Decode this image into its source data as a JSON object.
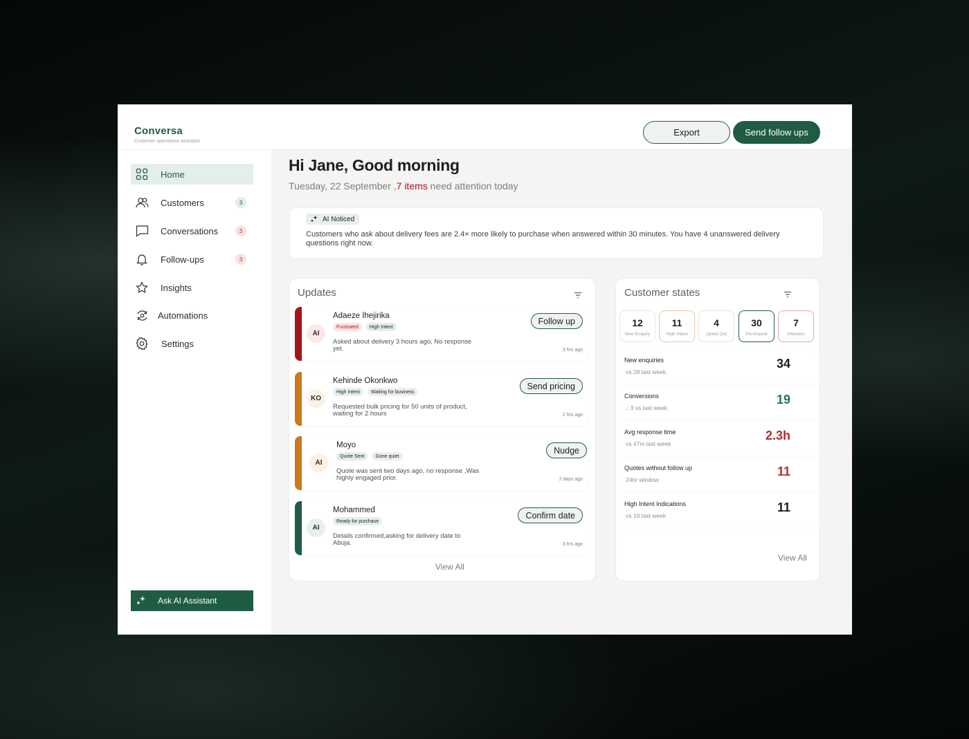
{
  "app": {
    "name": "Conversa",
    "tagline": "Customer operations assistant"
  },
  "header": {
    "export_label": "Export",
    "send_label": "Send follow ups"
  },
  "sidebar": {
    "items": [
      {
        "label": "Home",
        "icon": "grid-icon",
        "badge": ""
      },
      {
        "label": "Customers",
        "icon": "users-icon",
        "badge": "3"
      },
      {
        "label": "Conversations",
        "icon": "chat-icon",
        "badge": "3"
      },
      {
        "label": "Follow-ups",
        "icon": "bell-icon",
        "badge": "3"
      },
      {
        "label": "Insights",
        "icon": "star-icon",
        "badge": ""
      },
      {
        "label": "Automations",
        "icon": "automation-icon",
        "badge": ""
      },
      {
        "label": "Settings",
        "icon": "gear-icon",
        "badge": ""
      }
    ],
    "ask_ai_label": "Ask AI Assistant"
  },
  "greeting": {
    "title": "Hi Jane, Good morning",
    "date": "Tuesday, 22 September ,",
    "count": "7 items",
    "suffix": "need attention today"
  },
  "notice": {
    "tag": "AI Noticed",
    "text": "Customers who ask about delivery fees are 2.4× more likely to purchase when answered within 30 minutes. You have 4 unanswered delivery questions right now."
  },
  "updates": {
    "title": "Updates",
    "view_all": "View All",
    "items": [
      {
        "initials": "AI",
        "name": "Adaeze Ihejirika",
        "tags": [
          "Frustrated",
          "High Intent"
        ],
        "desc": "Asked about delivery 3 hours ago, No response yet.",
        "time": "3 hrs ago",
        "action": "Follow up"
      },
      {
        "initials": "KO",
        "name": "Kehinde Okonkwo",
        "tags": [
          "High Intent",
          "Waiting for business"
        ],
        "desc": "Requested bulk pricing for 50 units of product, waiting for 2 hours",
        "time": "2 hrs ago",
        "action": "Send pricing"
      },
      {
        "initials": "AI",
        "name": "Moyo",
        "tags": [
          "Quote Sent",
          "Gone quiet"
        ],
        "desc": "Quote was sent two days ago, no response ,Was highly engaged prior.",
        "time": "2 days ago",
        "action": "Nudge"
      },
      {
        "initials": "AI",
        "name": "Mohammed",
        "tags": [
          "Ready for purchase"
        ],
        "desc": "Details confirmed,asking for delivery date to Abuja.",
        "time": "3 hrs ago",
        "action": "Confirm date"
      }
    ]
  },
  "customer_states": {
    "title": "Customer states",
    "view_all": "View All",
    "states": [
      {
        "value": "12",
        "label": "New Enquiry"
      },
      {
        "value": "11",
        "label": "High Intent"
      },
      {
        "value": "4",
        "label": "Opted Out"
      },
      {
        "value": "30",
        "label": "Purchased"
      },
      {
        "value": "7",
        "label": "Attention"
      }
    ],
    "metrics": [
      {
        "label": "New enquiries",
        "sub": "vs 28 last week",
        "value": "34"
      },
      {
        "label": "Conversions",
        "sub": "↓ 3 vs last week",
        "value": "19"
      },
      {
        "label": "Avg response time",
        "sub": "vs 47m last week",
        "value": "2.3h"
      },
      {
        "label": "Quotes without follow up",
        "sub": "24hr window",
        "value": "11"
      },
      {
        "label": "High Intent Indications",
        "sub": "vs 10 last week",
        "value": "11"
      }
    ]
  },
  "colors": {
    "brand": "#1f5c43",
    "alert": "#b0121b",
    "stripe_red": "#a3141c",
    "stripe_orange": "#c9781c",
    "positive": "#1f7a52",
    "negative": "#b42c2c"
  }
}
